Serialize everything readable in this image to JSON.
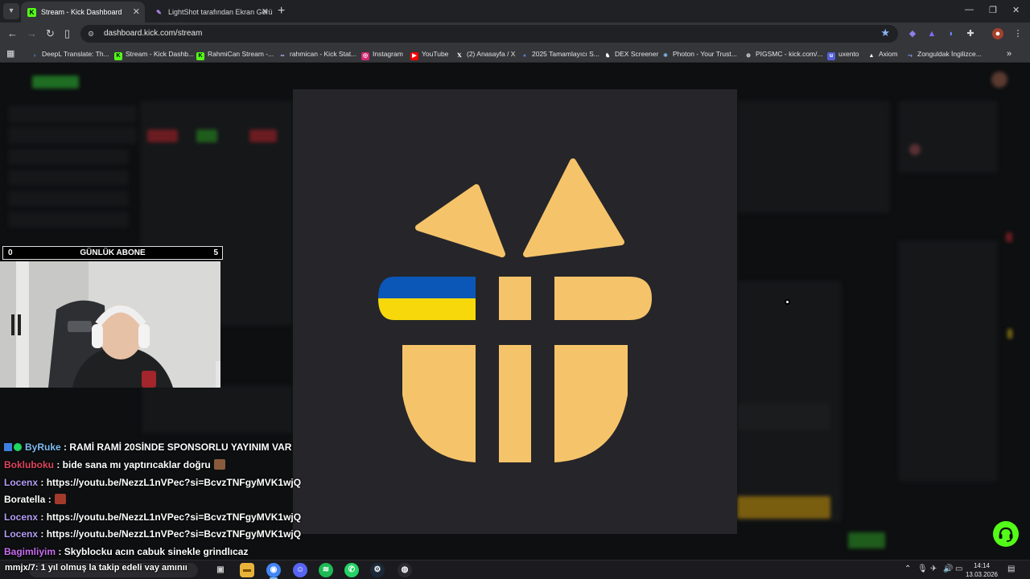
{
  "browser": {
    "tabs": [
      {
        "title": "Stream - Kick Dashboard",
        "active": true
      },
      {
        "title": "LightShot tarafından Ekran Görü",
        "active": false
      }
    ],
    "url": "dashboard.kick.com/stream",
    "bookmarks": [
      "DeepL Translate: Th...",
      "Stream - Kick Dashb...",
      "RahmiCan Stream -...",
      "rahmican - Kick Stat...",
      "Instagram",
      "YouTube",
      "(2) Anasayfa / X",
      "2025 Tamamlayıcı S...",
      "DEX Screener",
      "Photon - Your Trust...",
      "PIGSMC - kick.com/...",
      "uxento",
      "Axiom",
      "Zonguldak İngilizce..."
    ]
  },
  "overlay": {
    "sub_counter": {
      "current": "0",
      "label": "GÜNLÜK ABONE",
      "goal": "5"
    }
  },
  "chat": [
    {
      "user": "ByRuke",
      "message": ": RAMİ RAMİ 20SİNDE SPONSORLU YAYINIM VAR",
      "color": "#7fbdf3",
      "badges": true,
      "emote": false
    },
    {
      "user": "Bokluboku",
      "message": ": bide sana mı yaptırıcaklar doğru",
      "color": "#e0455f",
      "badges": false,
      "emote": true
    },
    {
      "user": "Locenx",
      "message": ": https://youtu.be/NezzL1nVPec?si=BcvzTNFgyMVK1wjQ",
      "color": "#b49cf6",
      "badges": false,
      "emote": false
    },
    {
      "user": "Boratella",
      "message": ":",
      "color": "#ffffff",
      "badges": false,
      "emote": true
    },
    {
      "user": "Locenx",
      "message": ": https://youtu.be/NezzL1nVPec?si=BcvzTNFgyMVK1wjQ",
      "color": "#b49cf6",
      "badges": false,
      "emote": false
    },
    {
      "user": "Locenx",
      "message": ": https://youtu.be/NezzL1nVPec?si=BcvzTNFgyMVK1wjQ",
      "color": "#b49cf6",
      "badges": false,
      "emote": false
    },
    {
      "user": "Bagimliyim",
      "message": ": Skyblocku acın cabuk sinekle grindlıcaz",
      "color": "#c86cf0",
      "badges": false,
      "emote": false
    }
  ],
  "caption": "mmjx/7: 1 yıl olmuş la takip edeli vay amınıı",
  "taskbar": {
    "time": "14:14",
    "date": "13.03.2026"
  },
  "colors": {
    "kick_green": "#53fc18",
    "logo_gold": "#f5c46a",
    "ukraine_blue": "#0b57b7",
    "ukraine_yellow": "#f7d90b"
  }
}
